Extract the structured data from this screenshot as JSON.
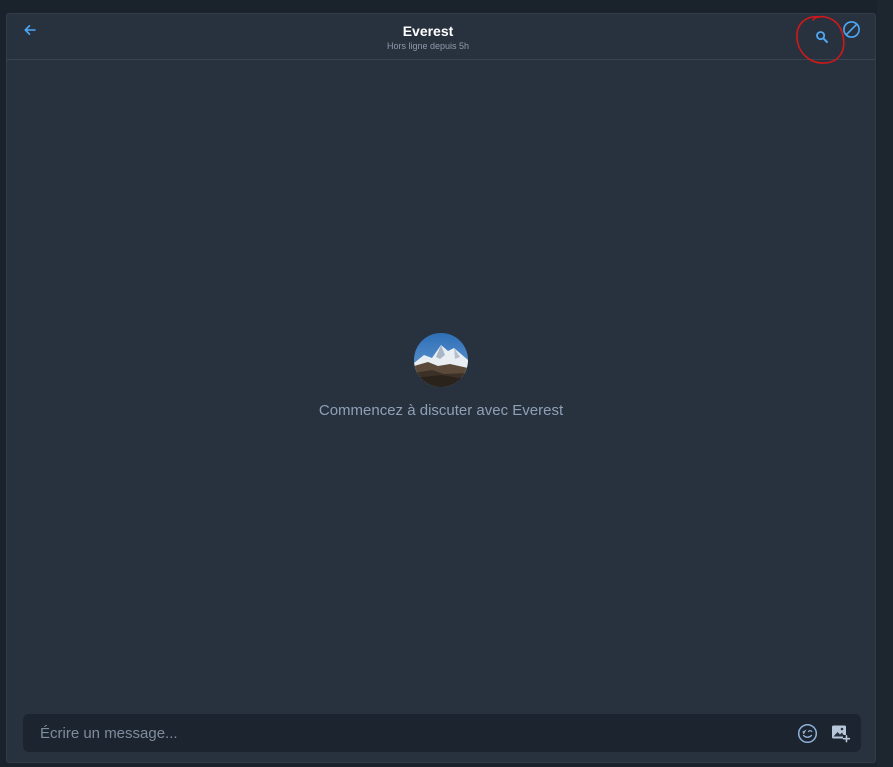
{
  "header": {
    "title": "Everest",
    "subtitle": "Hors ligne depuis 5h",
    "back_icon": "arrow-left-icon",
    "search_icon": "search-icon",
    "block_icon": "block-icon",
    "accent_color": "#4ea8f5"
  },
  "empty_state": {
    "avatar_icon": "everest-avatar",
    "message": "Commencez à discuter avec Everest"
  },
  "composer": {
    "placeholder": "Écrire un message...",
    "value": "",
    "emoji_icon": "emoji-icon",
    "image_icon": "add-image-icon"
  },
  "annotation": {
    "color": "#d01818"
  }
}
